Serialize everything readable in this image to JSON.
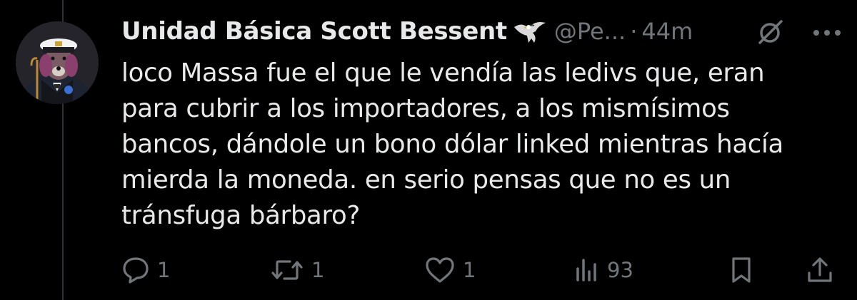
{
  "post": {
    "author_name": "Unidad Básica Scott Bessent",
    "badge_icon": "eagle-icon",
    "handle": "@Pe...",
    "separator": "·",
    "timestamp": "44m",
    "text_lines": [
      "loco Massa fue el que le vendía las ledivs que, eran",
      "para cubrir a los importadores, a los mismísimos",
      "bancos, dándole un bono dólar linked mientras hacía",
      "mierda la moneda. en serio pensas que no es un",
      "tránsfuga bárbaro?"
    ]
  },
  "actions": {
    "reply_count": "1",
    "repost_count": "1",
    "like_count": "1",
    "views_count": "93"
  },
  "colors": {
    "background": "#000000",
    "text": "#e7e9ea",
    "muted": "#71767b",
    "thread_line": "#2f3336"
  }
}
